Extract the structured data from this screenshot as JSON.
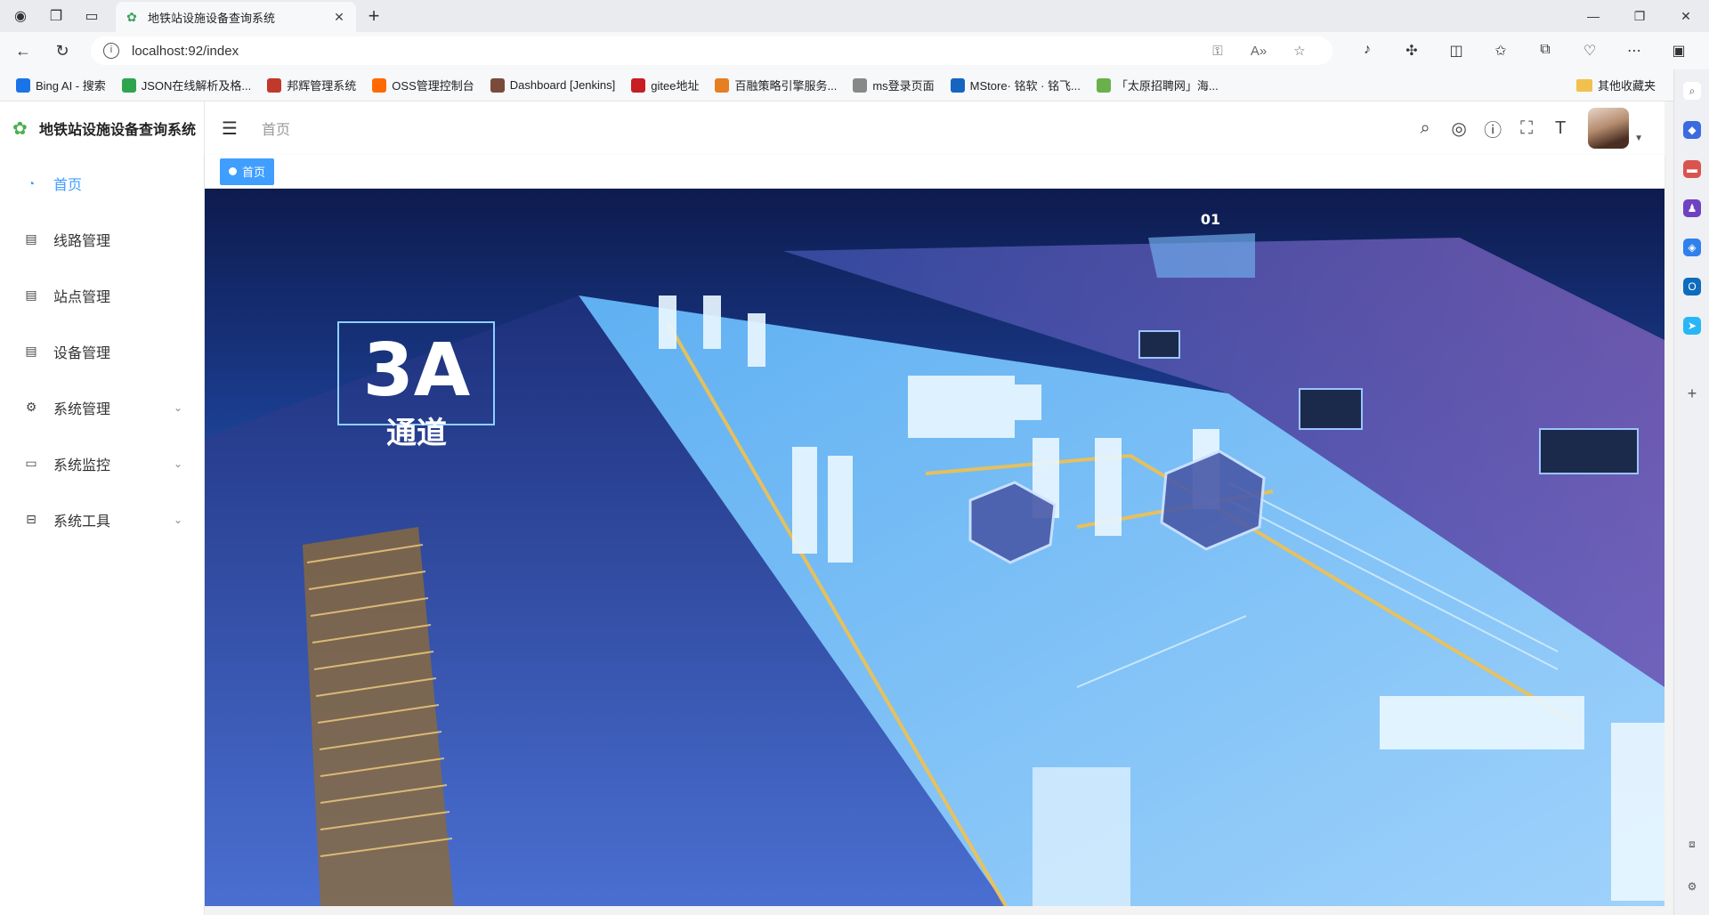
{
  "browser": {
    "tab_title": "地铁站设施设备查询系统",
    "url": "localhost:92/index",
    "bookmarks": [
      {
        "label": "Bing AI - 搜索",
        "color": "#1a73e8"
      },
      {
        "label": "JSON在线解析及格...",
        "color": "#2ea44f"
      },
      {
        "label": "邦辉管理系统",
        "color": "#c0392b"
      },
      {
        "label": "OSS管理控制台",
        "color": "#ff6a00"
      },
      {
        "label": "Dashboard [Jenkins]",
        "color": "#7a4b3a"
      },
      {
        "label": "gitee地址",
        "color": "#c71d23"
      },
      {
        "label": "百融策略引擎服务...",
        "color": "#e67e22"
      },
      {
        "label": "ms登录页面",
        "color": "#888888"
      },
      {
        "label": "MStore· 铭软 · 铭飞...",
        "color": "#1565c0"
      },
      {
        "label": "「太原招聘网」海...",
        "color": "#6ab04c"
      }
    ],
    "other_bookmarks": "其他收藏夹"
  },
  "app": {
    "logo_title": "地铁站设施设备查询系统",
    "breadcrumb": "首页",
    "tag_label": "首页",
    "accent": "#409eff",
    "menu": [
      {
        "label": "首页",
        "icon": "dashboard-icon",
        "active": true,
        "has_children": false
      },
      {
        "label": "线路管理",
        "icon": "document-icon",
        "active": false,
        "has_children": false
      },
      {
        "label": "站点管理",
        "icon": "document-icon",
        "active": false,
        "has_children": false
      },
      {
        "label": "设备管理",
        "icon": "document-icon",
        "active": false,
        "has_children": false
      },
      {
        "label": "系统管理",
        "icon": "gear-icon",
        "active": false,
        "has_children": true
      },
      {
        "label": "系统监控",
        "icon": "monitor-icon",
        "active": false,
        "has_children": true
      },
      {
        "label": "系统工具",
        "icon": "toolbox-icon",
        "active": false,
        "has_children": true
      }
    ]
  },
  "banner": {
    "big_text": "3A",
    "sub_text": "通道",
    "badge_text": "01"
  }
}
